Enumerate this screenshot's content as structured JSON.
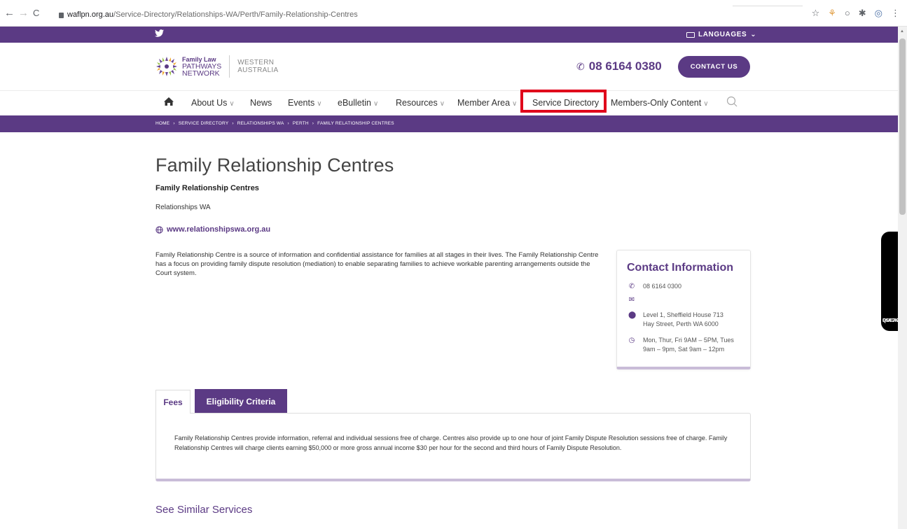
{
  "browser": {
    "back": "←",
    "forward": "→",
    "reload": "C",
    "url_host": "waflpn.org.au",
    "url_path": "/Service-Directory/Relationships-WA/Perth/Family-Relationship-Centres"
  },
  "topbar": {
    "twitter_icon": "twitter-icon",
    "languages_label": "LANGUAGES"
  },
  "header": {
    "logo_line1": "Family Law",
    "logo_line2": "PATHWAYS",
    "logo_line3": "NETWORK",
    "region_line1": "WESTERN",
    "region_line2": "AUSTRALIA",
    "phone": "08 6164 0380",
    "contact_button": "CONTACT US"
  },
  "nav": {
    "items": [
      {
        "label": "About Us",
        "dropdown": true
      },
      {
        "label": "News",
        "dropdown": false
      },
      {
        "label": "Events",
        "dropdown": true
      },
      {
        "label": "eBulletin",
        "dropdown": true
      },
      {
        "label": "Resources",
        "dropdown": true
      },
      {
        "label": "Member Area",
        "dropdown": true
      },
      {
        "label": "Service Directory",
        "dropdown": false
      },
      {
        "label": "Members-Only Content",
        "dropdown": true
      }
    ]
  },
  "breadcrumb": [
    "HOME",
    "SERVICE DIRECTORY",
    "RELATIONSHIPS WA",
    "PERTH",
    "FAMILY RELATIONSHIP CENTRES"
  ],
  "main": {
    "title": "Family Relationship Centres",
    "subtitle": "Family Relationship Centres",
    "organisation": "Relationships WA",
    "website": "www.relationshipswa.org.au",
    "description": "Family Relationship Centre is a source of information and confidential assistance for families at all stages in their lives. The Family Relationship Centre has a focus on providing family dispute resolution (mediation) to enable separating families to achieve workable parenting arrangements outside the Court system."
  },
  "contact": {
    "heading": "Contact Information",
    "phone": "08 6164 0300",
    "email": "",
    "address": "Level 1, Sheffield House 713 Hay Street, Perth WA 6000",
    "hours": "Mon, Thur, Fri 9AM – 5PM, Tues 9am – 9pm, Sat 9am – 12pm"
  },
  "tabs": {
    "fees_label": "Fees",
    "eligibility_label": "Eligibility Criteria",
    "fees_text": "Family Relationship Centres provide information, referral and individual sessions free of charge. Centres also provide up to one hour of joint Family Dispute Resolution sessions free of charge. Family Relationship Centres will charge clients earning $50,000 or more gross annual income $30 per hour for the second and third hours of Family Dispute Resolution."
  },
  "similar_heading": "See Similar Services",
  "quick_escape": {
    "line1": "QUICK",
    "line2": "ESCAPE"
  },
  "colors": {
    "brand_purple": "#5b3a84",
    "highlight_red": "#e0001b",
    "accent_lavender": "#c9bcd8"
  }
}
